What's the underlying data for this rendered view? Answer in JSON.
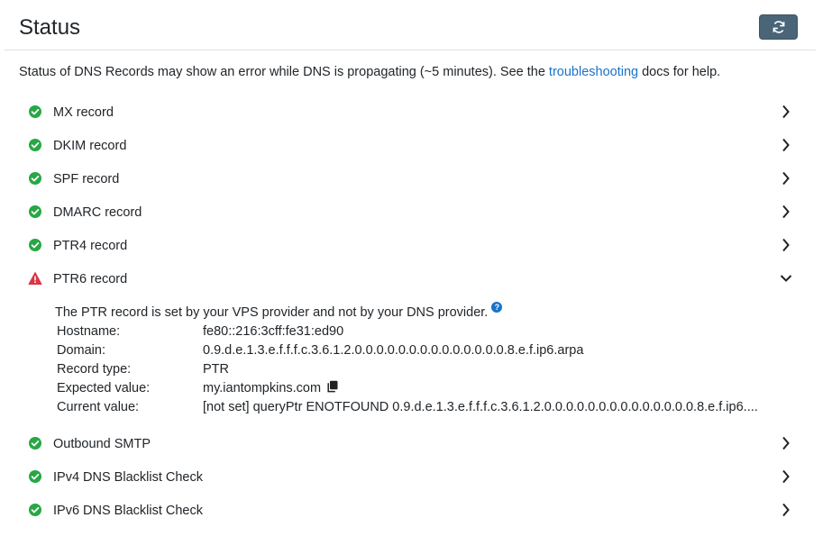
{
  "header": {
    "title": "Status",
    "refresh_icon": "refresh-icon"
  },
  "notice": {
    "before": "Status of DNS Records may show an error while DNS is propagating (~5 minutes). See the ",
    "link": "troubleshooting",
    "after": " docs for help."
  },
  "colors": {
    "ok": "#28a745",
    "error": "#dc3545",
    "link": "#1a73c9",
    "button": "#4a6478"
  },
  "checks": [
    {
      "label": "MX record",
      "status": "ok"
    },
    {
      "label": "DKIM record",
      "status": "ok"
    },
    {
      "label": "SPF record",
      "status": "ok"
    },
    {
      "label": "DMARC record",
      "status": "ok"
    },
    {
      "label": "PTR4 record",
      "status": "ok"
    },
    {
      "label": "PTR6 record",
      "status": "error",
      "expanded": true
    },
    {
      "label": "Outbound SMTP",
      "status": "ok"
    },
    {
      "label": "IPv4 DNS Blacklist Check",
      "status": "ok"
    },
    {
      "label": "IPv6 DNS Blacklist Check",
      "status": "ok"
    }
  ],
  "ptr6": {
    "description": "The PTR record is set by your VPS provider and not by your DNS provider.",
    "help_icon_label": "?",
    "fields": [
      {
        "key": "Hostname:",
        "value": "fe80::216:3cff:fe31:ed90"
      },
      {
        "key": "Domain:",
        "value": "0.9.d.e.1.3.e.f.f.f.c.3.6.1.2.0.0.0.0.0.0.0.0.0.0.0.0.0.0.8.e.f.ip6.arpa"
      },
      {
        "key": "Record type:",
        "value": "PTR"
      },
      {
        "key": "Expected value:",
        "value": "my.iantompkins.com"
      },
      {
        "key": "Current value:",
        "value": "[not set] queryPtr ENOTFOUND 0.9.d.e.1.3.e.f.f.f.c.3.6.1.2.0.0.0.0.0.0.0.0.0.0.0.0.0.0.8.e.f.ip6...."
      }
    ]
  }
}
